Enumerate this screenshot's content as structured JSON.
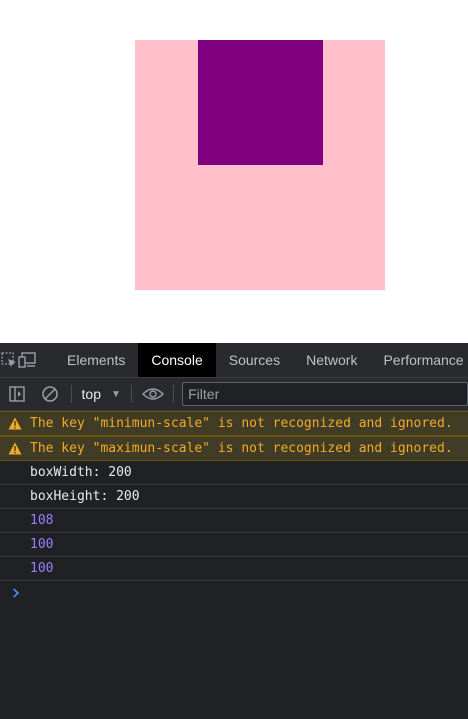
{
  "devtools": {
    "tabs": [
      {
        "label": "Elements"
      },
      {
        "label": "Console"
      },
      {
        "label": "Sources"
      },
      {
        "label": "Network"
      },
      {
        "label": "Performance"
      }
    ],
    "active_tab": "Console",
    "toolbar": {
      "context": "top",
      "filter_placeholder": "Filter"
    },
    "colors": {
      "warning_text": "#f2ab26",
      "number_text": "#9980ff",
      "prompt": "#4e8cff"
    },
    "console_messages": [
      {
        "type": "warning",
        "text": "The key \"minimun-scale\" is not recognized and ignored."
      },
      {
        "type": "warning",
        "text": "The key \"maximun-scale\" is not recognized and ignored."
      },
      {
        "type": "log",
        "text": "boxWidth: 200"
      },
      {
        "type": "log",
        "text": "boxHeight: 200"
      },
      {
        "type": "number",
        "text": "108"
      },
      {
        "type": "number",
        "text": "100"
      },
      {
        "type": "number",
        "text": "100"
      }
    ],
    "prompt_symbol": "›"
  },
  "page": {
    "outer_box_color": "#ffc0cb",
    "inner_box_color": "#800080"
  }
}
